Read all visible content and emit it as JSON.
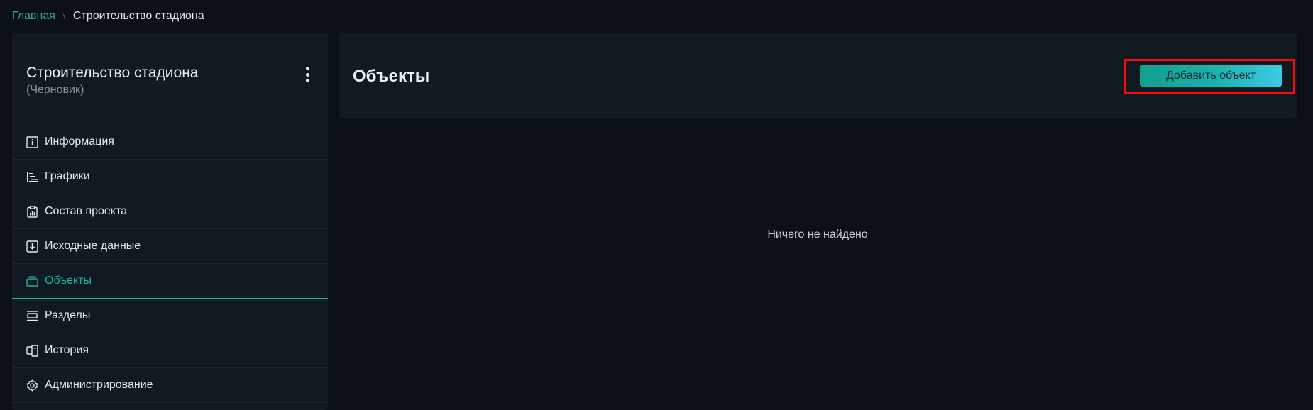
{
  "breadcrumb": {
    "home": "Главная",
    "separator": "›",
    "current": "Строительство стадиона"
  },
  "project": {
    "title": "Строительство стадиона",
    "status": "(Черновик)"
  },
  "sidebar": {
    "items": [
      {
        "label": "Информация",
        "icon": "info-icon"
      },
      {
        "label": "Графики",
        "icon": "gantt-icon"
      },
      {
        "label": "Состав проекта",
        "icon": "clipboard-chart-icon"
      },
      {
        "label": "Исходные данные",
        "icon": "download-box-icon"
      },
      {
        "label": "Объекты",
        "icon": "layers-icon",
        "active": true
      },
      {
        "label": "Разделы",
        "icon": "sections-icon"
      },
      {
        "label": "История",
        "icon": "history-icon"
      },
      {
        "label": "Администрирование",
        "icon": "gear-icon"
      }
    ]
  },
  "main": {
    "title": "Объекты",
    "add_button": "Добавить объект",
    "empty_message": "Ничего не найдено"
  },
  "colors": {
    "accent": "#1fb3a0",
    "highlight": "#ff0a0a",
    "background": "#0b1016",
    "panel": "#121a21"
  }
}
